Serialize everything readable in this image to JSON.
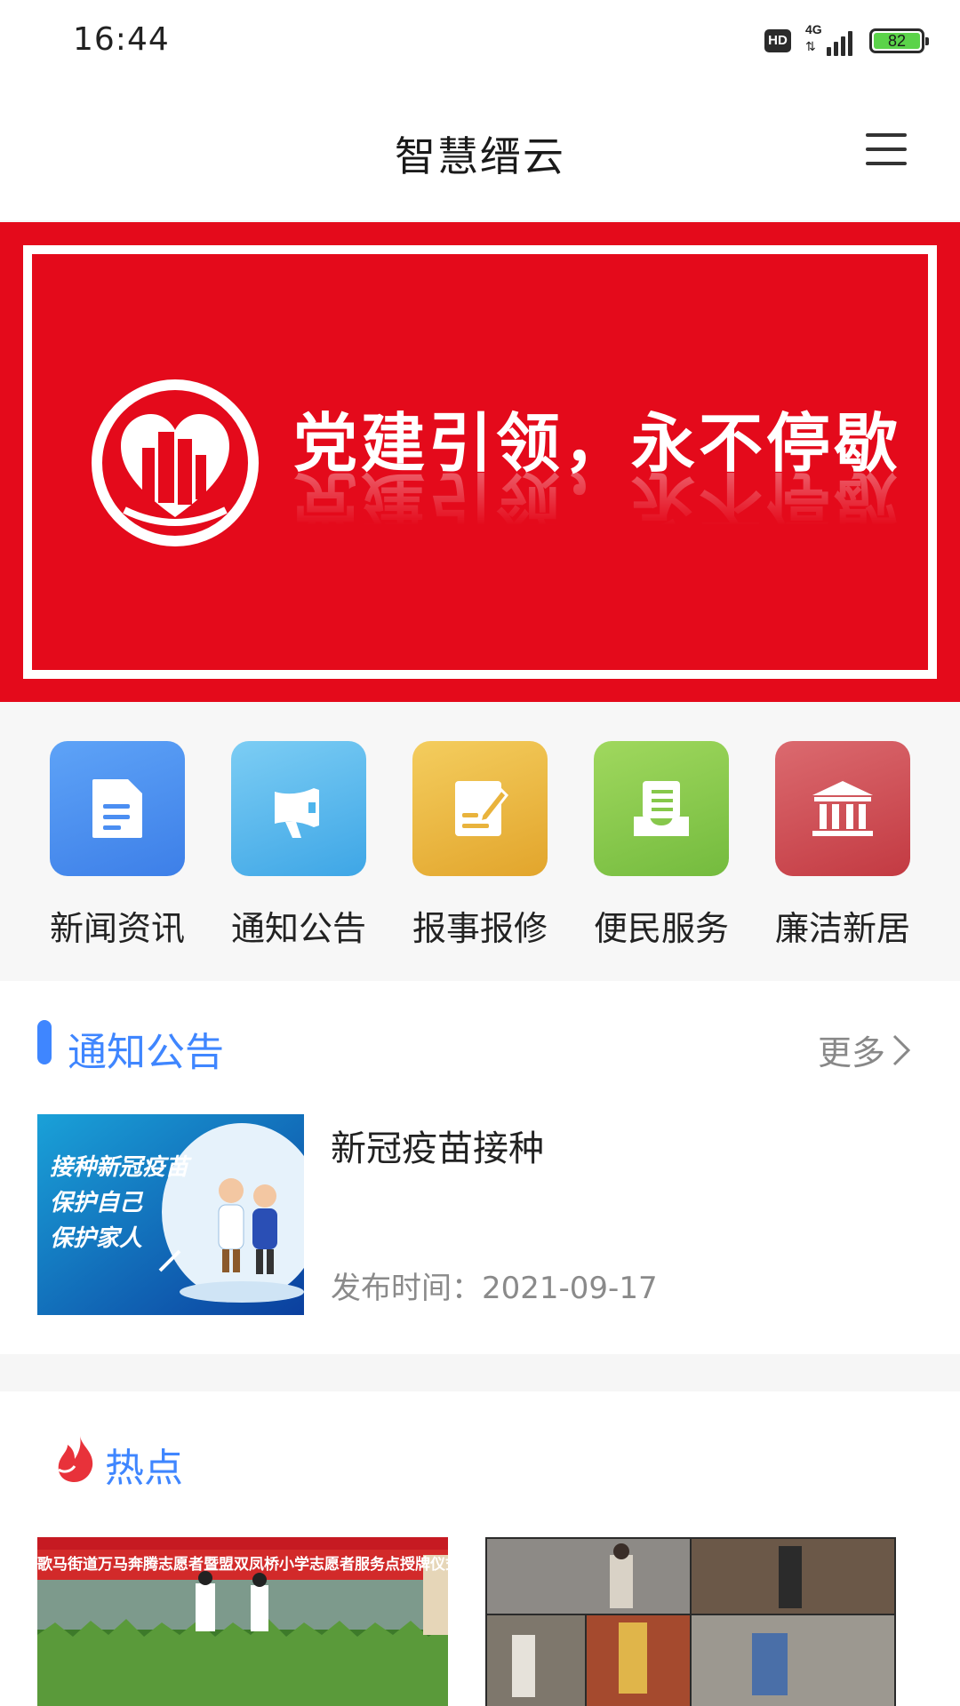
{
  "status_bar": {
    "time": "16:44",
    "hd_label": "HD",
    "network_label": "4G",
    "battery_level": "82"
  },
  "header": {
    "title": "智慧缙云",
    "menu_icon": "hamburger-menu-icon"
  },
  "banner": {
    "slogan": "党建引领，永不停歇",
    "background_color": "#e40a1b"
  },
  "quick_nav": [
    {
      "label": "新闻资讯",
      "icon": "document-icon",
      "color": "#4b8ef2"
    },
    {
      "label": "通知公告",
      "icon": "megaphone-icon",
      "color": "#4fb5ec"
    },
    {
      "label": "报事报修",
      "icon": "edit-note-icon",
      "color": "#e9b33c"
    },
    {
      "label": "便民服务",
      "icon": "inbox-list-icon",
      "color": "#86c84a"
    },
    {
      "label": "廉洁新居",
      "icon": "bank-building-icon",
      "color": "#d0464d"
    }
  ],
  "notice_section": {
    "title": "通知公告",
    "more_label": "更多",
    "items": [
      {
        "title": "新冠疫苗接种",
        "date_label": "发布时间：2021-09-17",
        "thumb_lines": [
          "接种新冠疫苗",
          "保护自己",
          "保护家人"
        ]
      }
    ]
  },
  "hot_section": {
    "title": "热点",
    "cards": [
      {
        "banner_text": "歌马街道万马奔腾志愿者暨盟双凤桥小学志愿者服务点授牌仪式"
      },
      {
        "banner_text": ""
      }
    ]
  },
  "colors": {
    "accent": "#3f86ff",
    "hot_red": "#e8323a"
  }
}
